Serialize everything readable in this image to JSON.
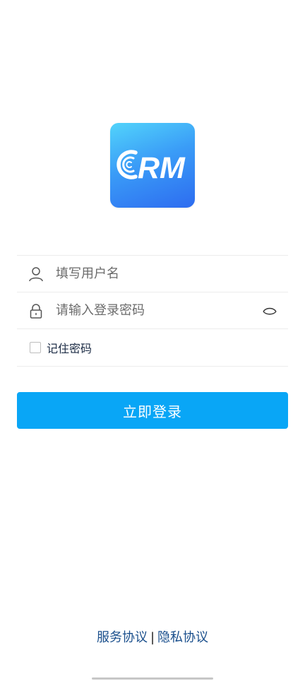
{
  "app": {
    "logo_text": "CRM",
    "colors": {
      "logo_gradient_start": "#52d4fb",
      "logo_gradient_end": "#2d6cf0",
      "primary_button": "#09a6f6",
      "link": "#1a4f8c"
    }
  },
  "form": {
    "username": {
      "placeholder": "填写用户名",
      "value": "",
      "icon": "user-icon"
    },
    "password": {
      "placeholder": "请输入登录密码",
      "value": "",
      "icon": "lock-icon",
      "toggle_icon": "eye-closed-icon"
    },
    "remember": {
      "label": "记住密码",
      "checked": false
    }
  },
  "login_button": {
    "label": "立即登录"
  },
  "footer": {
    "service_agreement": "服务协议",
    "separator": "|",
    "privacy_policy": "隐私协议"
  }
}
